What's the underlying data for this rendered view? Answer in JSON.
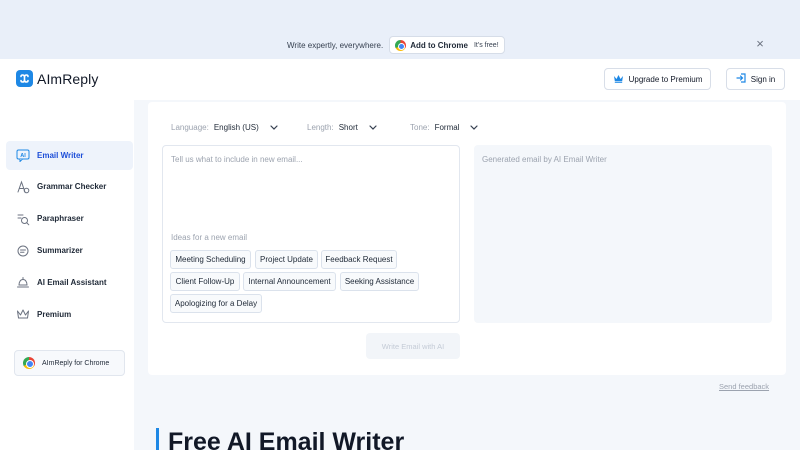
{
  "promo": {
    "text": "Write expertly, everywhere.",
    "chrome_label": "Add to Chrome",
    "free_label": "It's free!",
    "close": "×"
  },
  "header": {
    "logo": "AImReply",
    "upgrade_label": "Upgrade to Premium",
    "signin_label": "Sign in"
  },
  "sidebar": {
    "items": [
      {
        "label": "Email Writer",
        "icon": "ai-chat-icon",
        "active": true
      },
      {
        "label": "Grammar Checker",
        "icon": "grammar-icon",
        "active": false
      },
      {
        "label": "Paraphraser",
        "icon": "paraphrase-icon",
        "active": false
      },
      {
        "label": "Summarizer",
        "icon": "summarize-icon",
        "active": false
      },
      {
        "label": "AI Email Assistant",
        "icon": "assistant-icon",
        "active": false
      },
      {
        "label": "Premium",
        "icon": "crown-icon",
        "active": false
      }
    ],
    "chrome_label": "AImReply for Chrome"
  },
  "options": {
    "language_key": "Language:",
    "language_value": "English (US)",
    "length_key": "Length:",
    "length_value": "Short",
    "tone_key": "Tone:",
    "tone_value": "Formal"
  },
  "input": {
    "placeholder": "Tell us what to include in new email...",
    "ideas_label": "Ideas for a new email",
    "ideas": [
      "Meeting Scheduling",
      "Project Update",
      "Feedback Request",
      "Client Follow-Up",
      "Internal Announcement",
      "Seeking Assistance",
      "Apologizing for a Delay"
    ]
  },
  "output": {
    "placeholder": "Generated email by AI Email Writer"
  },
  "actions": {
    "write_label": "Write Email with AI",
    "feedback_label": "Send feedback"
  },
  "page": {
    "heading": "Free AI Email Writer"
  },
  "colors": {
    "accent": "#1e88e5",
    "promo_bg": "#e9eff9",
    "main_bg": "#f4f7fb",
    "active_nav_bg": "#eef3fb"
  }
}
